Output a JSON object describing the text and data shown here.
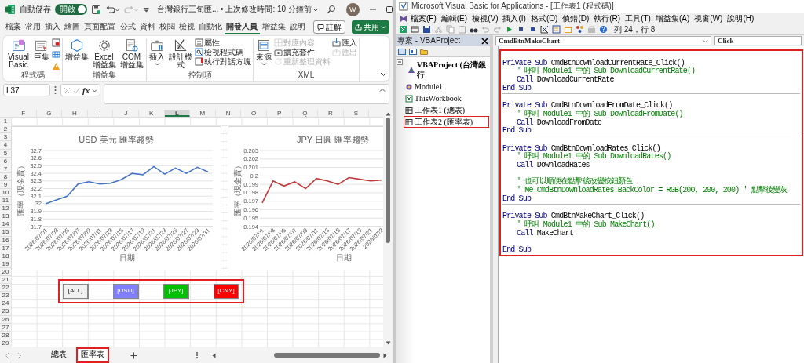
{
  "excel": {
    "title_bar": {
      "autosave_label": "自動儲存",
      "autosave_on": true,
      "toggle_text": "開啟",
      "document_title": "台灣銀行三旬匯... • 上次修改時間: 10 分鐘前",
      "avatar": "W"
    },
    "ribbon_tabs": [
      {
        "label": "檔案",
        "selected": false
      },
      {
        "label": "常用",
        "selected": false
      },
      {
        "label": "插入",
        "selected": false
      },
      {
        "label": "繪圖",
        "selected": false
      },
      {
        "label": "頁面配置",
        "selected": false
      },
      {
        "label": "公式",
        "selected": false
      },
      {
        "label": "資料",
        "selected": false
      },
      {
        "label": "校閱",
        "selected": false
      },
      {
        "label": "檢視",
        "selected": false
      },
      {
        "label": "自動化",
        "selected": false
      },
      {
        "label": "開發人員",
        "selected": true
      },
      {
        "label": "增益集",
        "selected": false
      },
      {
        "label": "說明",
        "selected": false
      }
    ],
    "comments_button": "註解",
    "share_button": "共用",
    "ribbon": {
      "groups": [
        {
          "label": "程式碼",
          "columns": [
            {
              "kind": "large",
              "label": "Visual Basic",
              "dropdown": false
            },
            {
              "kind": "large",
              "label": "巨集",
              "dropdown": false
            },
            {
              "kind": "icons"
            }
          ]
        },
        {
          "label": "增益集",
          "columns": [
            {
              "kind": "large",
              "label": "增益集",
              "dropdown": false
            },
            {
              "kind": "large",
              "label": "Excel 增益集",
              "dropdown": false
            },
            {
              "kind": "large",
              "label": "COM 增益集",
              "dropdown": false
            }
          ]
        },
        {
          "label": "控制項",
          "columns": [
            {
              "kind": "large",
              "label": "插入",
              "dropdown": true
            },
            {
              "kind": "large",
              "label": "設計模式",
              "dropdown": false
            },
            {
              "kind": "smalls",
              "items": [
                {
                  "label": "屬性",
                  "disabled": false
                },
                {
                  "label": "檢視程式碼",
                  "disabled": false
                },
                {
                  "label": "執行對話方塊",
                  "disabled": false
                }
              ]
            }
          ]
        },
        {
          "label": "XML",
          "columns": [
            {
              "kind": "large",
              "label": "來源",
              "dropdown": true
            },
            {
              "kind": "smalls",
              "items": [
                {
                  "label": "對應內容",
                  "disabled": true
                },
                {
                  "label": "擴充套件",
                  "disabled": false
                },
                {
                  "label": "重新整理資料",
                  "disabled": true
                }
              ]
            },
            {
              "kind": "smalls",
              "items": [
                {
                  "label": "匯入",
                  "disabled": false
                },
                {
                  "label": "匯出",
                  "disabled": true
                }
              ]
            }
          ]
        }
      ]
    },
    "formula_bar": {
      "name_box": "L37",
      "function_label": "fx"
    },
    "sheet": {
      "columns": [
        {
          "label": "F",
          "selected": false
        },
        {
          "label": "G",
          "selected": false
        },
        {
          "label": "H",
          "selected": false
        },
        {
          "label": "I",
          "selected": false
        },
        {
          "label": "J",
          "selected": false
        },
        {
          "label": "K",
          "selected": false
        },
        {
          "label": "L",
          "selected": true
        },
        {
          "label": "M",
          "selected": false
        },
        {
          "label": "N",
          "selected": false
        },
        {
          "label": "O",
          "selected": false
        },
        {
          "label": "P",
          "selected": false
        },
        {
          "label": "Q",
          "selected": false
        },
        {
          "label": "R",
          "selected": false
        },
        {
          "label": "S",
          "selected": false
        }
      ],
      "rows": [
        "1",
        "2",
        "3",
        "4",
        "5",
        "6",
        "7",
        "8",
        "9",
        "10",
        "11",
        "12",
        "13",
        "14",
        "15",
        "16",
        "17",
        "18",
        "19",
        "20",
        "21",
        "22",
        "23",
        "24",
        "25",
        "26",
        "27",
        "28",
        "29"
      ],
      "charts": [
        {
          "chart_data": {
            "type": "line",
            "grid": true,
            "title": "USD 美元 匯率趨勢",
            "xlabel": "日期",
            "ylabel": "匯率（現金賣）",
            "categories": [
              "2026/07/01",
              "2026/07/03",
              "2026/07/05",
              "2026/07/07",
              "2026/07/09",
              "2026/07/11",
              "2026/07/13",
              "2026/07/15",
              "2026/07/17",
              "2026/07/19",
              "2026/07/21",
              "2026/07/23",
              "2026/07/25",
              "2026/07/27",
              "2026/07/29",
              "2026/07/31"
            ],
            "ylim": [
              31.7,
              32.7
            ],
            "yticks": [
              31.7,
              31.8,
              31.9,
              32,
              32.1,
              32.2,
              32.3,
              32.4,
              32.5,
              32.6,
              32.7
            ],
            "series": [
              {
                "color": "#4472c4",
                "values": [
                  32.0,
                  32.05,
                  32.1,
                  32.26,
                  32.29,
                  32.26,
                  32.27,
                  32.32,
                  32.4,
                  32.38,
                  32.49,
                  32.39,
                  32.47,
                  32.4,
                  32.48,
                  32.42
                ]
              }
            ]
          }
        },
        {
          "chart_data": {
            "type": "line",
            "grid": true,
            "title": "JPY 日圓 匯率趨勢",
            "xlabel": "日期",
            "ylabel": "匯率（現金賣）",
            "categories": [
              "2026/07/01",
              "2026/07/03",
              "2026/07/05",
              "2026/07/07",
              "2026/07/09",
              "2026/07/11",
              "2026/07/13",
              "2026/07/15",
              "2026/07/17",
              "2026/07/19",
              "2026/07/21",
              "2026/07/2"
            ],
            "ylim": [
              0.194,
              0.203
            ],
            "yticks": [
              0.194,
              0.195,
              0.196,
              0.197,
              0.198,
              0.199,
              0.2,
              0.201,
              0.202,
              0.203
            ],
            "series": [
              {
                "color": "#c0393b",
                "values": [
                  0.1968,
                  0.1994,
                  0.1988,
                  0.1993,
                  0.1985,
                  0.1997,
                  0.1994,
                  0.199,
                  0.1998,
                  0.1996,
                  0.1994,
                  0.1995
                ]
              }
            ]
          }
        }
      ],
      "buttons": {
        "highlighted": true,
        "items": [
          {
            "label": "[ALL]",
            "color": "#f0f0f0"
          },
          {
            "label": "[USD]",
            "color": "#8080ff"
          },
          {
            "label": "[JPY]",
            "color": "#00c000"
          },
          {
            "label": "[CNY]",
            "color": "#ff0000"
          }
        ]
      }
    },
    "sheet_tabs": [
      {
        "label": "總表",
        "selected": false,
        "highlighted": false
      },
      {
        "label": "匯率表",
        "selected": true,
        "highlighted": true
      }
    ]
  },
  "vba": {
    "title": "Microsoft Visual Basic for Applications - [工作表1 (程式碼)]",
    "menu": [
      "檔案(F)",
      "編輯(E)",
      "檢視(V)",
      "插入(I)",
      "格式(O)",
      "偵錯(D)",
      "執行(R)",
      "工具(T)",
      "增益集(A)",
      "視窗(W)",
      "說明(H)"
    ],
    "cursor_position": "列 24，行 8",
    "project": {
      "title": "專案 - VBAProject",
      "root": {
        "label": "VBAProject (台灣銀行",
        "expanded": true,
        "children": [
          {
            "label": "Module1",
            "highlighted": false
          },
          {
            "label": "ThisWorkbook",
            "highlighted": false
          },
          {
            "label": "工作表1 (總表)",
            "highlighted": false
          },
          {
            "label": "工作表2 (匯率表)",
            "highlighted": true
          }
        ]
      }
    },
    "code": {
      "object": "CmdBtnMakeChart",
      "procedure": "Click",
      "highlighted": true,
      "procedures": [
        {
          "lines": [
            {
              "kind": "code",
              "indented": false,
              "tokens": [
                {
                  "kind": "keyword",
                  "text": "Private Sub"
                },
                {
                  "kind": "plain",
                  "text": "CmdBtnDownloadCurrentRate_Click()"
                }
              ]
            },
            {
              "kind": "code",
              "indented": true,
              "tokens": [
                {
                  "kind": "comment",
                  "text": "' 呼叫 Module1 中的 Sub DownloadCurrentRate()"
                }
              ]
            },
            {
              "kind": "code",
              "indented": true,
              "tokens": [
                {
                  "kind": "keyword",
                  "text": "Call"
                },
                {
                  "kind": "plain",
                  "text": "DownloadCurrentRate"
                }
              ]
            },
            {
              "kind": "code",
              "indented": false,
              "tokens": [
                {
                  "kind": "keyword",
                  "text": "End Sub"
                }
              ]
            }
          ]
        },
        {
          "lines": [
            {
              "kind": "code",
              "indented": false,
              "tokens": [
                {
                  "kind": "keyword",
                  "text": "Private Sub"
                },
                {
                  "kind": "plain",
                  "text": "CmdBtnDownloadFromDate_Click()"
                }
              ]
            },
            {
              "kind": "code",
              "indented": true,
              "tokens": [
                {
                  "kind": "comment",
                  "text": "' 呼叫 Module1 中的 Sub DownloadFromDate()"
                }
              ]
            },
            {
              "kind": "code",
              "indented": true,
              "tokens": [
                {
                  "kind": "keyword",
                  "text": "Call"
                },
                {
                  "kind": "plain",
                  "text": "DownloadFromDate"
                }
              ]
            },
            {
              "kind": "code",
              "indented": false,
              "tokens": [
                {
                  "kind": "keyword",
                  "text": "End Sub"
                }
              ]
            }
          ]
        },
        {
          "lines": [
            {
              "kind": "code",
              "indented": false,
              "tokens": [
                {
                  "kind": "keyword",
                  "text": "Private Sub"
                },
                {
                  "kind": "plain",
                  "text": "CmdBtnDownloadRates_Click()"
                }
              ]
            },
            {
              "kind": "code",
              "indented": true,
              "tokens": [
                {
                  "kind": "comment",
                  "text": "' 呼叫 Module1 中的 Sub DownloadRates()"
                }
              ]
            },
            {
              "kind": "code",
              "indented": true,
              "tokens": [
                {
                  "kind": "keyword",
                  "text": "Call"
                },
                {
                  "kind": "plain",
                  "text": "DownloadRates"
                }
              ]
            },
            {
              "kind": "blank"
            },
            {
              "kind": "code",
              "indented": true,
              "tokens": [
                {
                  "kind": "comment",
                  "text": "' 也可以順便在點擊後改變按鈕顏色"
                }
              ]
            },
            {
              "kind": "code",
              "indented": true,
              "tokens": [
                {
                  "kind": "comment",
                  "text": "' Me.CmdBtnDownloadRates.BackColor = RGB(200, 200, 200) ' 點擊後變灰"
                }
              ]
            },
            {
              "kind": "code",
              "indented": false,
              "tokens": [
                {
                  "kind": "keyword",
                  "text": "End Sub"
                }
              ]
            }
          ]
        },
        {
          "lines": [
            {
              "kind": "code",
              "indented": false,
              "tokens": [
                {
                  "kind": "keyword",
                  "text": "Private Sub"
                },
                {
                  "kind": "plain",
                  "text": "CmdBtnMakeChart_Click()"
                }
              ]
            },
            {
              "kind": "code",
              "indented": true,
              "tokens": [
                {
                  "kind": "comment",
                  "text": "' 呼叫 Module1 中的 Sub MakeChart()"
                }
              ]
            },
            {
              "kind": "code",
              "indented": true,
              "tokens": [
                {
                  "kind": "keyword",
                  "text": "Call"
                },
                {
                  "kind": "plain",
                  "text": "MakeChart"
                }
              ]
            },
            {
              "kind": "blank"
            },
            {
              "kind": "code",
              "indented": false,
              "tokens": [
                {
                  "kind": "keyword",
                  "text": "End Sub"
                }
              ]
            }
          ]
        }
      ]
    }
  }
}
